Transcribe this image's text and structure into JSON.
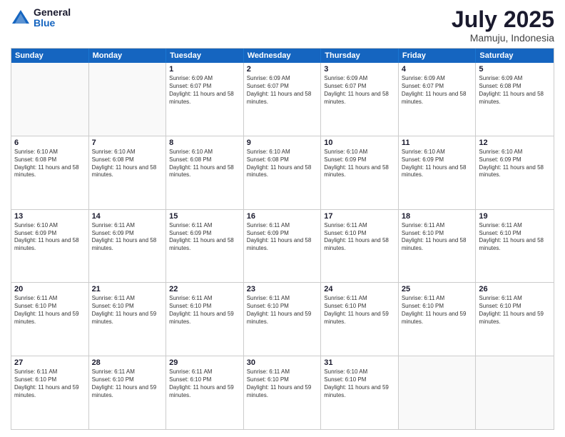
{
  "header": {
    "logo": {
      "general": "General",
      "blue": "Blue"
    },
    "title": "July 2025",
    "location": "Mamuju, Indonesia"
  },
  "calendar": {
    "days": [
      "Sunday",
      "Monday",
      "Tuesday",
      "Wednesday",
      "Thursday",
      "Friday",
      "Saturday"
    ],
    "rows": [
      [
        {
          "day": "",
          "empty": true
        },
        {
          "day": "",
          "empty": true
        },
        {
          "day": "1",
          "sunrise": "6:09 AM",
          "sunset": "6:07 PM",
          "daylight": "11 hours and 58 minutes."
        },
        {
          "day": "2",
          "sunrise": "6:09 AM",
          "sunset": "6:07 PM",
          "daylight": "11 hours and 58 minutes."
        },
        {
          "day": "3",
          "sunrise": "6:09 AM",
          "sunset": "6:07 PM",
          "daylight": "11 hours and 58 minutes."
        },
        {
          "day": "4",
          "sunrise": "6:09 AM",
          "sunset": "6:07 PM",
          "daylight": "11 hours and 58 minutes."
        },
        {
          "day": "5",
          "sunrise": "6:09 AM",
          "sunset": "6:08 PM",
          "daylight": "11 hours and 58 minutes."
        }
      ],
      [
        {
          "day": "6",
          "sunrise": "6:10 AM",
          "sunset": "6:08 PM",
          "daylight": "11 hours and 58 minutes."
        },
        {
          "day": "7",
          "sunrise": "6:10 AM",
          "sunset": "6:08 PM",
          "daylight": "11 hours and 58 minutes."
        },
        {
          "day": "8",
          "sunrise": "6:10 AM",
          "sunset": "6:08 PM",
          "daylight": "11 hours and 58 minutes."
        },
        {
          "day": "9",
          "sunrise": "6:10 AM",
          "sunset": "6:08 PM",
          "daylight": "11 hours and 58 minutes."
        },
        {
          "day": "10",
          "sunrise": "6:10 AM",
          "sunset": "6:09 PM",
          "daylight": "11 hours and 58 minutes."
        },
        {
          "day": "11",
          "sunrise": "6:10 AM",
          "sunset": "6:09 PM",
          "daylight": "11 hours and 58 minutes."
        },
        {
          "day": "12",
          "sunrise": "6:10 AM",
          "sunset": "6:09 PM",
          "daylight": "11 hours and 58 minutes."
        }
      ],
      [
        {
          "day": "13",
          "sunrise": "6:10 AM",
          "sunset": "6:09 PM",
          "daylight": "11 hours and 58 minutes."
        },
        {
          "day": "14",
          "sunrise": "6:11 AM",
          "sunset": "6:09 PM",
          "daylight": "11 hours and 58 minutes."
        },
        {
          "day": "15",
          "sunrise": "6:11 AM",
          "sunset": "6:09 PM",
          "daylight": "11 hours and 58 minutes."
        },
        {
          "day": "16",
          "sunrise": "6:11 AM",
          "sunset": "6:09 PM",
          "daylight": "11 hours and 58 minutes."
        },
        {
          "day": "17",
          "sunrise": "6:11 AM",
          "sunset": "6:10 PM",
          "daylight": "11 hours and 58 minutes."
        },
        {
          "day": "18",
          "sunrise": "6:11 AM",
          "sunset": "6:10 PM",
          "daylight": "11 hours and 58 minutes."
        },
        {
          "day": "19",
          "sunrise": "6:11 AM",
          "sunset": "6:10 PM",
          "daylight": "11 hours and 58 minutes."
        }
      ],
      [
        {
          "day": "20",
          "sunrise": "6:11 AM",
          "sunset": "6:10 PM",
          "daylight": "11 hours and 59 minutes."
        },
        {
          "day": "21",
          "sunrise": "6:11 AM",
          "sunset": "6:10 PM",
          "daylight": "11 hours and 59 minutes."
        },
        {
          "day": "22",
          "sunrise": "6:11 AM",
          "sunset": "6:10 PM",
          "daylight": "11 hours and 59 minutes."
        },
        {
          "day": "23",
          "sunrise": "6:11 AM",
          "sunset": "6:10 PM",
          "daylight": "11 hours and 59 minutes."
        },
        {
          "day": "24",
          "sunrise": "6:11 AM",
          "sunset": "6:10 PM",
          "daylight": "11 hours and 59 minutes."
        },
        {
          "day": "25",
          "sunrise": "6:11 AM",
          "sunset": "6:10 PM",
          "daylight": "11 hours and 59 minutes."
        },
        {
          "day": "26",
          "sunrise": "6:11 AM",
          "sunset": "6:10 PM",
          "daylight": "11 hours and 59 minutes."
        }
      ],
      [
        {
          "day": "27",
          "sunrise": "6:11 AM",
          "sunset": "6:10 PM",
          "daylight": "11 hours and 59 minutes."
        },
        {
          "day": "28",
          "sunrise": "6:11 AM",
          "sunset": "6:10 PM",
          "daylight": "11 hours and 59 minutes."
        },
        {
          "day": "29",
          "sunrise": "6:11 AM",
          "sunset": "6:10 PM",
          "daylight": "11 hours and 59 minutes."
        },
        {
          "day": "30",
          "sunrise": "6:11 AM",
          "sunset": "6:10 PM",
          "daylight": "11 hours and 59 minutes."
        },
        {
          "day": "31",
          "sunrise": "6:10 AM",
          "sunset": "6:10 PM",
          "daylight": "11 hours and 59 minutes."
        },
        {
          "day": "",
          "empty": true
        },
        {
          "day": "",
          "empty": true
        }
      ]
    ]
  }
}
